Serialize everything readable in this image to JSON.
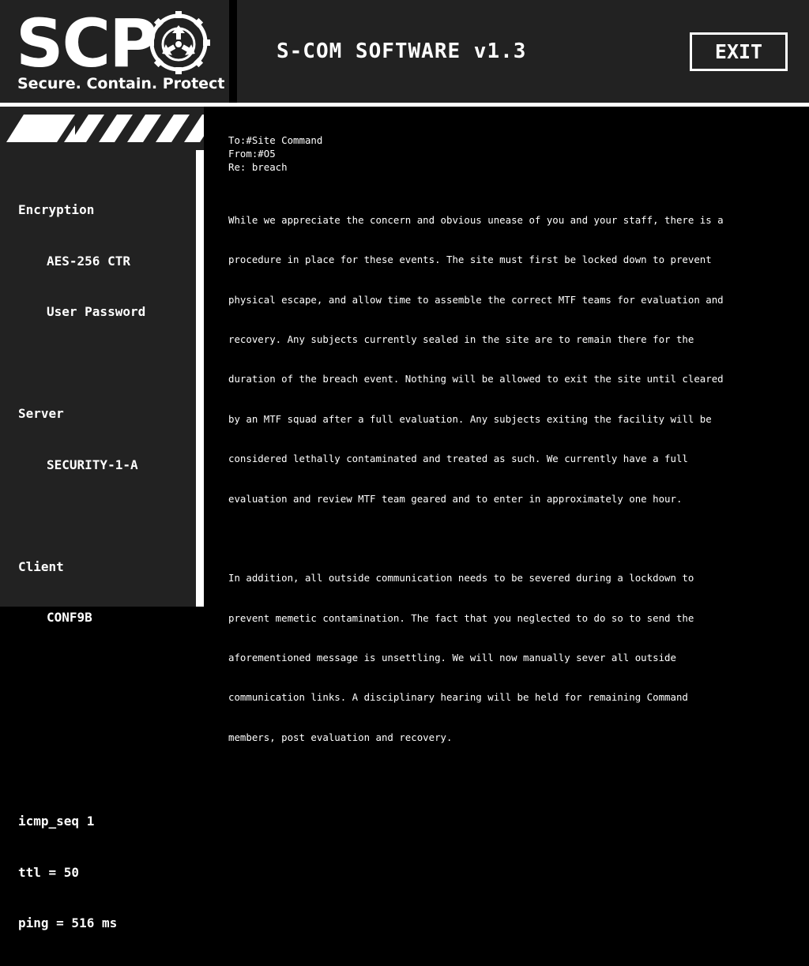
{
  "brand": {
    "logo_text": "SCP",
    "tagline": "Secure. Contain. Protect",
    "emblem_icon": "scp-emblem-icon"
  },
  "header": {
    "title": "S-COM SOFTWARE v1.3",
    "exit_label": "EXIT"
  },
  "sidebar": {
    "encryption_label": "Encryption",
    "encryption_cipher": "AES-256 CTR",
    "encryption_auth": "User Password",
    "server_label": "Server",
    "server_value": "SECURITY-1-A",
    "client_label": "Client",
    "client_value": "CONF9B",
    "icmp_seq": "icmp_seq 1",
    "ttl": "ttl = 50",
    "ping": "ping = 516 ms"
  },
  "message": {
    "to": "To:#Site Command",
    "from": "From:#O5",
    "re": "Re: breach",
    "paragraph_1_lines": [
      "While we appreciate the concern and obvious unease of you and your staff, there is a",
      "procedure in place for these events. The site must first be locked down to prevent",
      "physical escape, and allow time to assemble the correct MTF teams for evaluation and",
      "recovery. Any subjects currently sealed in the site are to remain there for the",
      "duration of the breach event. Nothing will be allowed to exit the site until cleared",
      "by an MTF squad after a full evaluation. Any subjects exiting the facility will be",
      "considered lethally contaminated and treated as such. We currently have a full",
      "evaluation and review MTF team geared and to enter in approximately one hour."
    ],
    "paragraph_2_lines": [
      "In addition, all outside communication needs to be severed during a lockdown to",
      "prevent memetic contamination. The fact that you neglected to do so to send the",
      "aforementioned message is unsettling. We will now manually sever all outside",
      "communication links. A disciplinary hearing will be held for remaining Command",
      "members, post evaluation and recovery."
    ]
  },
  "colors": {
    "panel": "#222222",
    "background": "#000000",
    "foreground": "#ffffff"
  }
}
